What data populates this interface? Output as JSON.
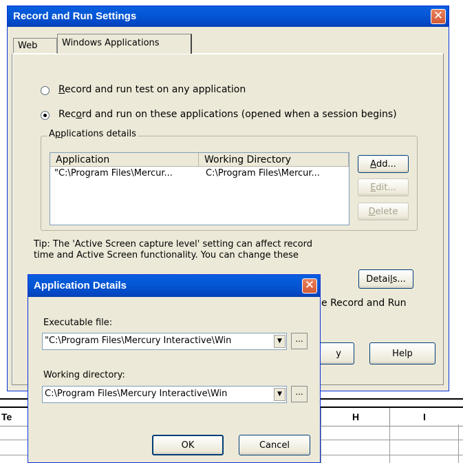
{
  "main_dialog": {
    "title": "Record and Run Settings",
    "close_glyph": "✕",
    "tabs": [
      {
        "label": "Web"
      },
      {
        "label": "Windows Applications"
      }
    ],
    "radio_any": {
      "prefix": "R",
      "rest": "ecord and run test on any application"
    },
    "radio_these": {
      "before": "Rec",
      "key": "o",
      "rest": "rd and run on these applications (opened when a session begins)"
    },
    "group_title": {
      "before": "A",
      "key": "p",
      "rest": "plications details"
    },
    "columns": [
      "Application",
      "Working Directory"
    ],
    "rows": [
      {
        "application": "\"C:\\Program Files\\Mercur...",
        "working_directory": "C:\\Program Files\\Mercur..."
      }
    ],
    "buttons": {
      "add": {
        "key": "A",
        "rest": "dd..."
      },
      "edit": {
        "key": "E",
        "rest": "dit..."
      },
      "delete": {
        "key": "D",
        "rest": "elete"
      },
      "details": {
        "before": "Detai",
        "key": "l",
        "rest": "s..."
      },
      "partial_ok": "y",
      "help": "Help"
    },
    "tip_line1": "Tip: The 'Active Screen capture level' setting can affect record",
    "tip_line2": "time and Active Screen functionality.  You can change these",
    "tip_line3_partial": "e Record and Run"
  },
  "sheet": {
    "columns": [
      "Te",
      "H",
      "I"
    ]
  },
  "app_dialog": {
    "title": "Application Details",
    "close_glyph": "✕",
    "executable_label": "Executable file:",
    "executable_value": "\"C:\\Program Files\\Mercury Interactive\\Win",
    "working_label": "Working directory:",
    "working_value": "C:\\Program Files\\Mercury Interactive\\Win",
    "browse_glyph": "...",
    "dropdown_glyph": "▼",
    "ok": "OK",
    "cancel": "Cancel"
  }
}
